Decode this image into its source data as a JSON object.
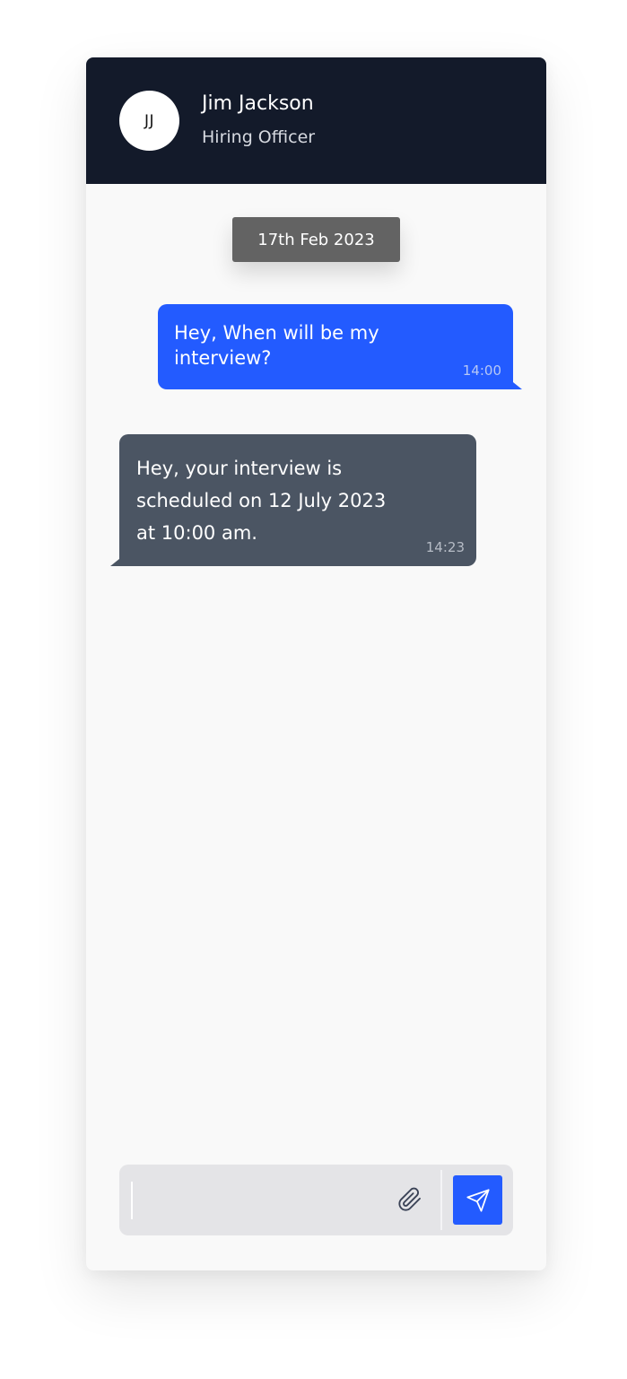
{
  "header": {
    "avatar_initials": "JJ",
    "name": "Jim Jackson",
    "role": "Hiring Officer"
  },
  "conversation": {
    "date": "17th Feb 2023",
    "messages": [
      {
        "direction": "outgoing",
        "text": "Hey, When will be my interview?",
        "time": "14:00"
      },
      {
        "direction": "incoming",
        "text": "Hey, your interview is scheduled on 12 July 2023 at 10:00 am.",
        "time": "14:23"
      }
    ]
  },
  "composer": {
    "value": "",
    "attach_icon": "paperclip-icon",
    "send_icon": "paper-plane-icon"
  },
  "colors": {
    "header_bg": "#131a2a",
    "outgoing_bubble": "#235bff",
    "incoming_bubble": "#4b5563",
    "date_chip": "#636363",
    "send_button": "#235bff"
  }
}
